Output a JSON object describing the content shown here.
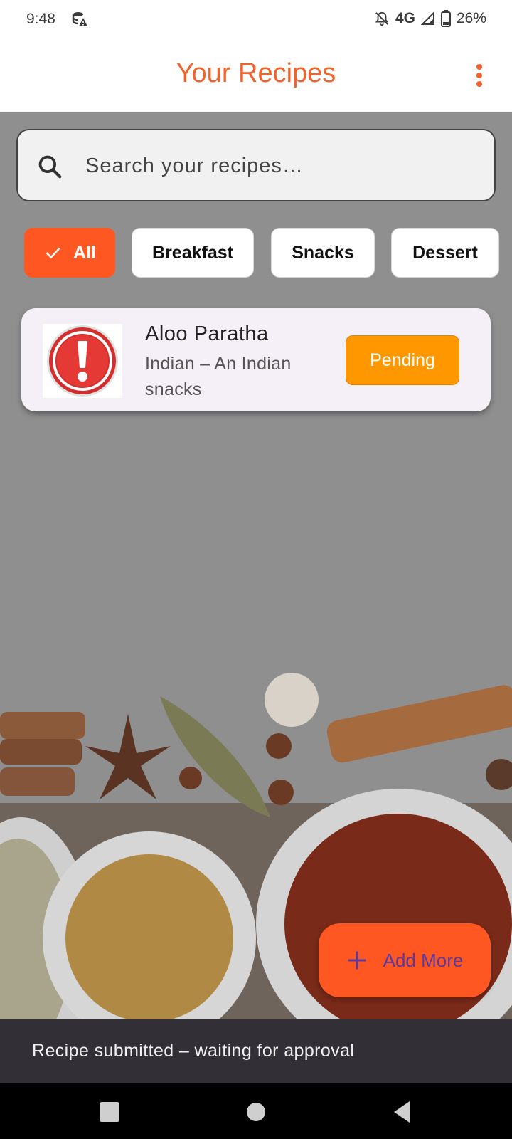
{
  "status_bar": {
    "time": "9:48",
    "network": "4G",
    "battery": "26%",
    "icons": [
      "database-warning-icon",
      "bell-off-icon",
      "signal-icon",
      "battery-icon"
    ]
  },
  "app_bar": {
    "title": "Your Recipes",
    "menu_icon": "more-vert-icon"
  },
  "search": {
    "placeholder": "Search your recipes…",
    "value": "",
    "icon": "search-icon"
  },
  "filters": {
    "chips": [
      {
        "label": "All",
        "selected": true
      },
      {
        "label": "Breakfast",
        "selected": false
      },
      {
        "label": "Snacks",
        "selected": false
      },
      {
        "label": "Dessert",
        "selected": false
      }
    ]
  },
  "recipes": [
    {
      "name": "Aloo Paratha",
      "description": "Indian – An Indian snacks",
      "status": "Pending",
      "thumbnail_icon": "error-exclamation-icon"
    }
  ],
  "fab": {
    "label": "Add More",
    "icon": "plus-icon"
  },
  "snackbar": {
    "message": "Recipe submitted – waiting for approval"
  },
  "colors": {
    "accent": "#ff5722",
    "title": "#f2622b",
    "pending": "#ff9800",
    "overlay": "#8f8f8f"
  }
}
